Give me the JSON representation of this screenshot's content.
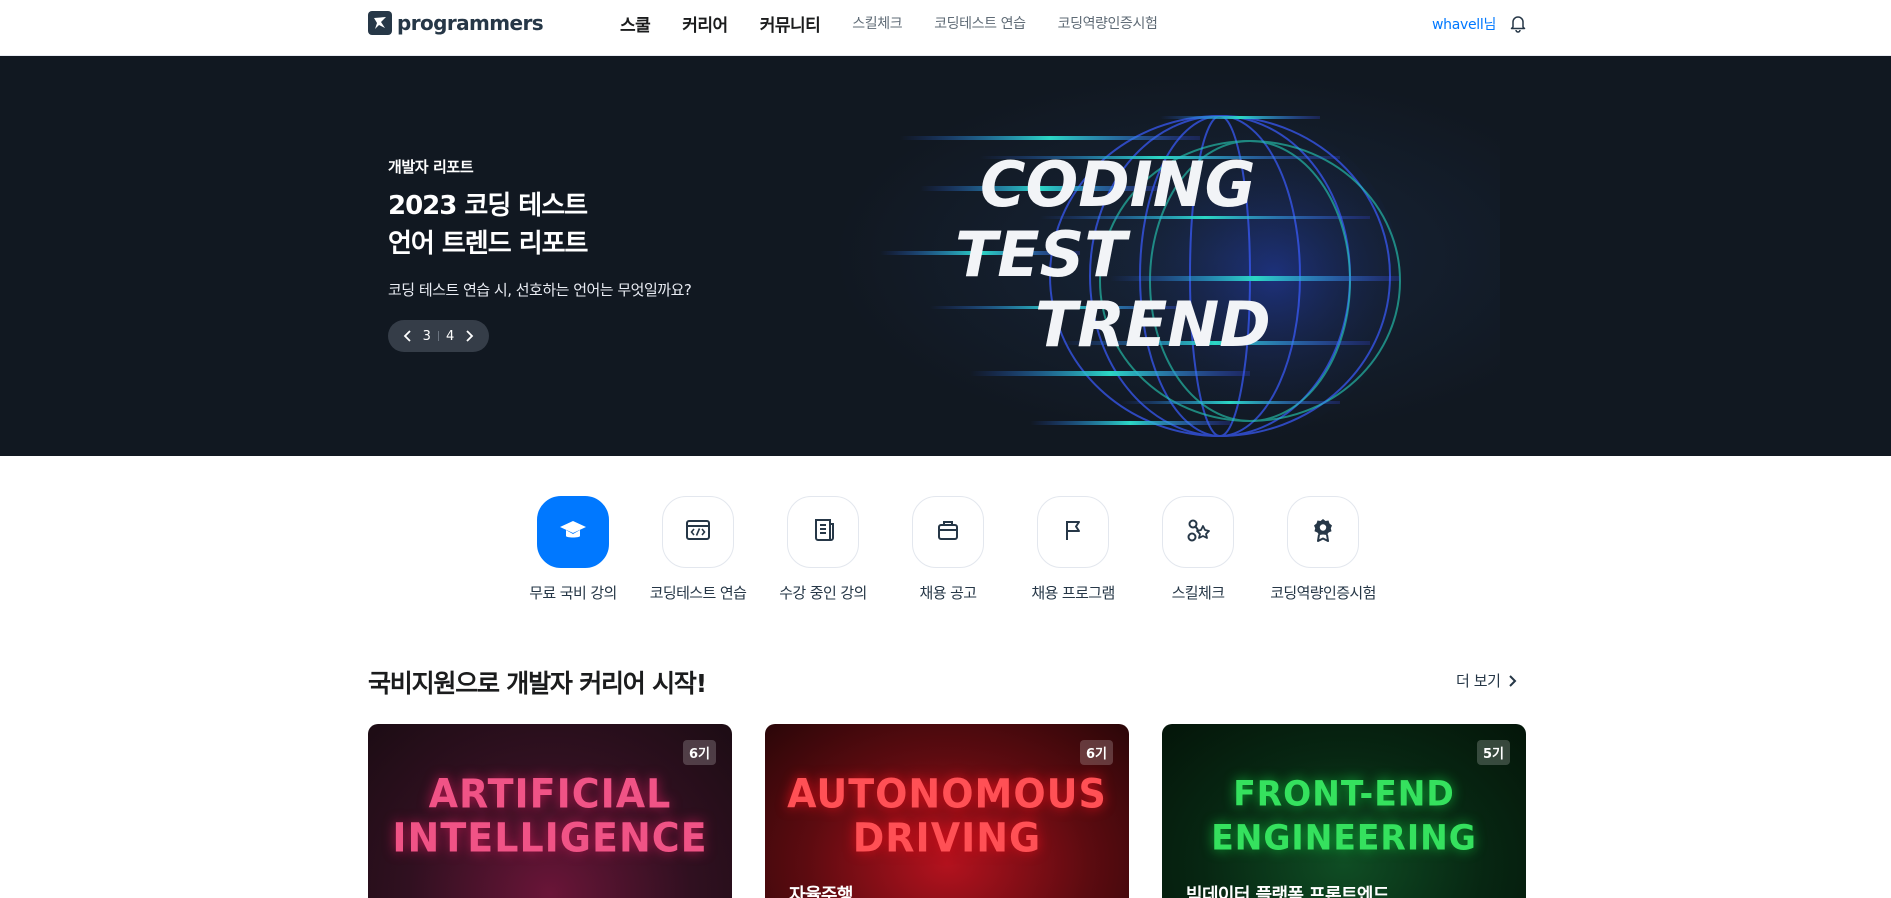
{
  "header": {
    "logo_text": "programmers",
    "nav_main": [
      "스쿨",
      "커리어",
      "커뮤니티"
    ],
    "nav_sub": [
      "스킬체크",
      "코딩테스트 연습",
      "코딩역량인증시험"
    ],
    "user": "whavell님"
  },
  "banner": {
    "eyebrow": "개발자 리포트",
    "title_line1": "2023 코딩 테스트",
    "title_line2": "언어 트렌드 리포트",
    "description": "코딩 테스트 연습 시, 선호하는 언어는 무엇일까요?",
    "current_page": "3",
    "total_pages": "4",
    "art_lines": [
      "CODING",
      "TEST",
      "TREND"
    ]
  },
  "shortcuts": [
    {
      "label": "무료 국비 강의",
      "icon": "graduation-cap-icon",
      "active": true
    },
    {
      "label": "코딩테스트 연습",
      "icon": "code-window-icon",
      "active": false
    },
    {
      "label": "수강 중인 강의",
      "icon": "document-icon",
      "active": false
    },
    {
      "label": "채용 공고",
      "icon": "briefcase-icon",
      "active": false
    },
    {
      "label": "채용 프로그램",
      "icon": "flag-icon",
      "active": false
    },
    {
      "label": "스킬체크",
      "icon": "skill-nodes-icon",
      "active": false
    },
    {
      "label": "코딩역량인증시험",
      "icon": "award-icon",
      "active": false
    }
  ],
  "section": {
    "title": "국비지원으로 개발자 커리어 시작!",
    "more_label": "더 보기"
  },
  "cards": [
    {
      "badge": "6기",
      "art_line1": "ARTIFICIAL",
      "art_line2": "INTELLIGENCE",
      "subtitle": ""
    },
    {
      "badge": "6기",
      "art_line1": "AUTONOMOUS",
      "art_line2": "DRIVING",
      "subtitle": "자율주행"
    },
    {
      "badge": "5기",
      "art_line1": "FRONT-END",
      "art_line2": "ENGINEERING",
      "subtitle": "빅데이터 플랫폼 프론트엔드"
    }
  ],
  "colors": {
    "accent": "#0078ff",
    "banner_bg": "#111821",
    "text": "#1b1c1d"
  }
}
